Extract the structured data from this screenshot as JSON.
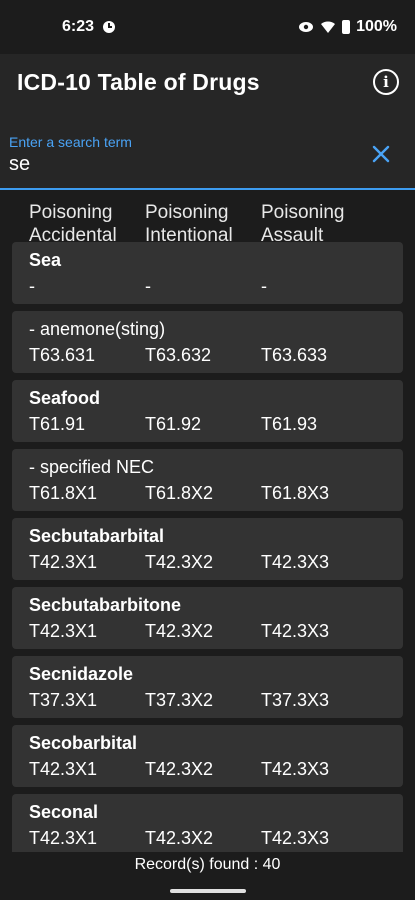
{
  "status": {
    "time": "6:23",
    "battery": "100%"
  },
  "appbar": {
    "title": "ICD-10 Table of Drugs"
  },
  "search": {
    "label": "Enter a search term",
    "value": "se"
  },
  "headers": {
    "col1_line1": "Poisoning",
    "col1_line2": "Accidental",
    "col2_line1": "Poisoning",
    "col2_line2": "Intentional",
    "col3_line1": "Poisoning",
    "col3_line2": "Assault"
  },
  "items": [
    {
      "name": "Sea",
      "accidental": "-",
      "intentional": "-",
      "assault": "-"
    },
    {
      "name": "- anemone(sting)",
      "accidental": "T63.631",
      "intentional": "T63.632",
      "assault": "T63.633"
    },
    {
      "name": "Seafood",
      "accidental": "T61.91",
      "intentional": "T61.92",
      "assault": "T61.93"
    },
    {
      "name": "- specified NEC",
      "accidental": "T61.8X1",
      "intentional": "T61.8X2",
      "assault": "T61.8X3"
    },
    {
      "name": "Secbutabarbital",
      "accidental": "T42.3X1",
      "intentional": "T42.3X2",
      "assault": "T42.3X3"
    },
    {
      "name": "Secbutabarbitone",
      "accidental": "T42.3X1",
      "intentional": "T42.3X2",
      "assault": "T42.3X3"
    },
    {
      "name": "Secnidazole",
      "accidental": "T37.3X1",
      "intentional": "T37.3X2",
      "assault": "T37.3X3"
    },
    {
      "name": "Secobarbital",
      "accidental": "T42.3X1",
      "intentional": "T42.3X2",
      "assault": "T42.3X3"
    },
    {
      "name": "Seconal",
      "accidental": "T42.3X1",
      "intentional": "T42.3X2",
      "assault": "T42.3X3"
    }
  ],
  "footer": {
    "records": "Record(s) found : 40"
  },
  "colors": {
    "accent": "#3d9cf0",
    "background": "#1c1c1c",
    "card": "#333333"
  },
  "icons": {
    "info": "info-icon",
    "clear": "close-icon",
    "wifi": "wifi-icon",
    "battery": "battery-icon"
  }
}
